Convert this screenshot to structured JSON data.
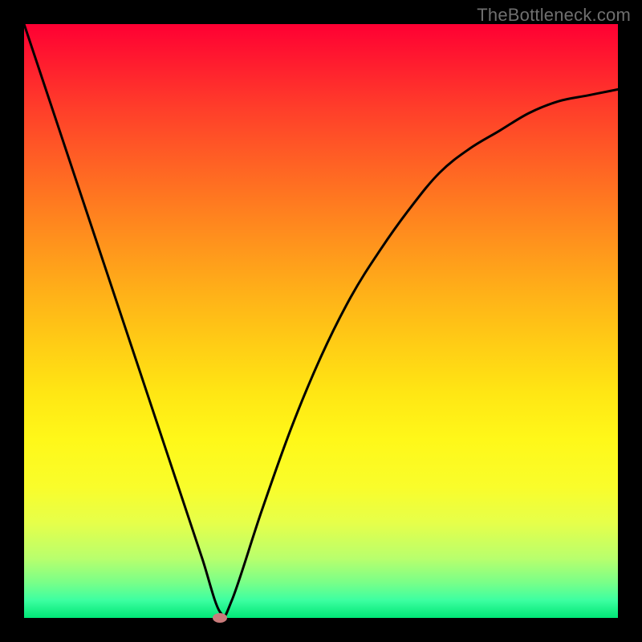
{
  "watermark": "TheBottleneck.com",
  "colors": {
    "frame": "#000000",
    "curve": "#000000",
    "marker": "#c97b7b",
    "gradient_top": "#ff0033",
    "gradient_bottom": "#00e676"
  },
  "chart_data": {
    "type": "line",
    "title": "",
    "xlabel": "",
    "ylabel": "",
    "xlim": [
      0,
      100
    ],
    "ylim": [
      0,
      100
    ],
    "grid": false,
    "legend": false,
    "annotations": [
      "TheBottleneck.com"
    ],
    "series": [
      {
        "name": "bottleneck-curve",
        "x": [
          0,
          3,
          6,
          9,
          12,
          15,
          18,
          21,
          24,
          27,
          30,
          33,
          35,
          40,
          45,
          50,
          55,
          60,
          65,
          70,
          75,
          80,
          85,
          90,
          95,
          100
        ],
        "y": [
          100,
          91,
          82,
          73,
          64,
          55,
          46,
          37,
          28,
          19,
          10,
          1,
          3,
          18,
          32,
          44,
          54,
          62,
          69,
          75,
          79,
          82,
          85,
          87,
          88,
          89
        ]
      }
    ],
    "marker": {
      "x": 33,
      "y": 0
    }
  }
}
